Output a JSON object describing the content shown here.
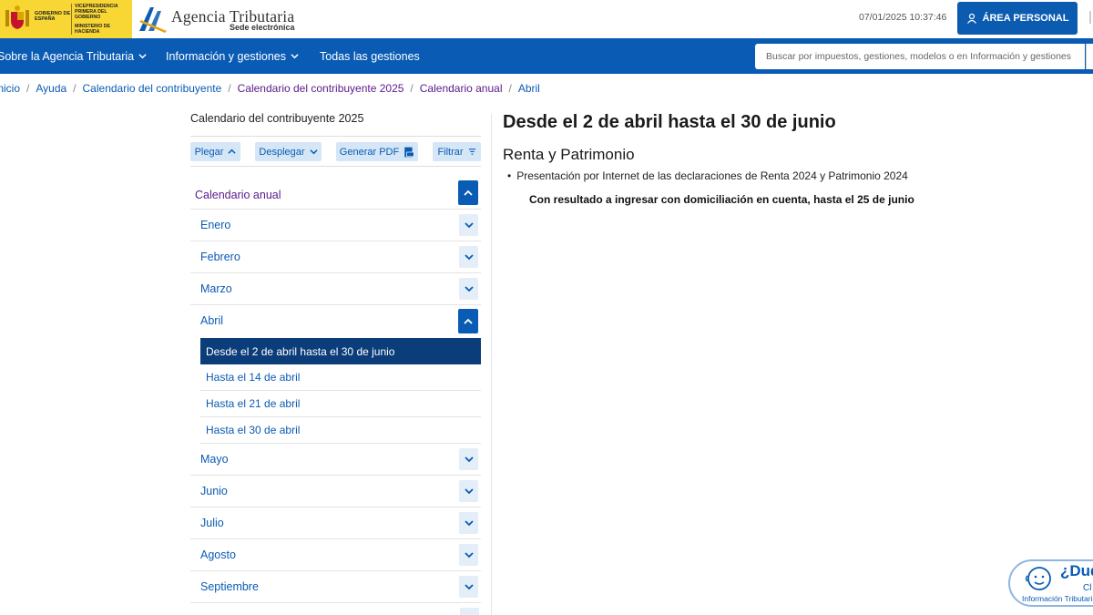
{
  "header": {
    "gov_text_main": "GOBIERNO DE ESPAÑA",
    "gov_text_vice": "VICEPRESIDENCIA PRIMERA DEL GOBIERNO",
    "gov_text_min": "MINISTERIO DE HACIENDA",
    "agency_title": "Agencia Tributaria",
    "agency_subtitle": "Sede electrónica",
    "datetime": "07/01/2025 10:37:46",
    "area_personal": "ÁREA PERSONAL"
  },
  "nav": {
    "items": [
      {
        "label": "Sobre la Agencia Tributaria",
        "has_chevron": true
      },
      {
        "label": "Información y gestiones",
        "has_chevron": true
      },
      {
        "label": "Todas las gestiones",
        "has_chevron": false
      }
    ],
    "search_placeholder": "Buscar por impuestos, gestiones, modelos o en Información y gestiones"
  },
  "breadcrumb": [
    "Inicio",
    "Ayuda",
    "Calendario del contribuyente",
    "Calendario del contribuyente 2025",
    "Calendario anual",
    "Abril"
  ],
  "sidebar": {
    "title": "Calendario del contribuyente 2025",
    "tools": [
      {
        "label": "Plegar",
        "icon": "chevron-up-icon"
      },
      {
        "label": "Desplegar",
        "icon": "chevron-down-icon"
      },
      {
        "label": "Generar PDF",
        "icon": "pdf-icon"
      },
      {
        "label": "Filtrar",
        "icon": "filter-icon"
      }
    ],
    "root": "Calendario anual",
    "months": [
      "Enero",
      "Febrero",
      "Marzo",
      "Abril",
      "Mayo",
      "Junio",
      "Julio",
      "Agosto",
      "Septiembre"
    ],
    "open_month": "Abril",
    "april_items": [
      "Desde el 2 de abril hasta el 30 de junio",
      "Hasta el 14 de abril",
      "Hasta el 21 de abril",
      "Hasta el 30 de abril"
    ],
    "active_item": "Desde el 2 de abril hasta el 30 de junio"
  },
  "main": {
    "title": "Desde el 2 de abril hasta el 30 de junio",
    "section": "Renta y Patrimonio",
    "bullet": "Presentación por Internet de las declaraciones de Renta 2024 y Patrimonio 2024",
    "note": "Con resultado a ingresar con domiciliación en cuenta, hasta el 25 de junio"
  },
  "help": {
    "question": "¿Dud",
    "cl": "Cl",
    "info": "Información Tributaria"
  },
  "colors": {
    "brand_blue": "#0a5bb4",
    "active_dark": "#0b3d7a",
    "gov_yellow": "#f8d634"
  }
}
